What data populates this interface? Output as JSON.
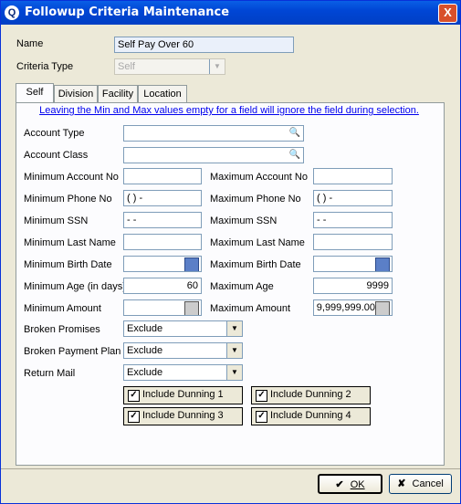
{
  "window": {
    "title": "Followup Criteria Maintenance",
    "close_glyph": "X",
    "icon": "search-app-icon"
  },
  "header": {
    "name_label": "Name",
    "name_value": "Self Pay Over 60",
    "criteria_type_label": "Criteria Type",
    "criteria_type_value": "Self"
  },
  "tabs": [
    {
      "label": "Self",
      "active": true
    },
    {
      "label": "Division",
      "active": false
    },
    {
      "label": "Facility",
      "active": false
    },
    {
      "label": "Location",
      "active": false
    }
  ],
  "notice": "Leaving the Min and Max values empty for a field will ignore the field during selection.",
  "fields": {
    "account_type": {
      "label": "Account Type",
      "value": ""
    },
    "account_class": {
      "label": "Account Class",
      "value": ""
    },
    "min_account_no": {
      "label": "Minimum Account No",
      "value": ""
    },
    "max_account_no": {
      "label": "Maximum Account No",
      "value": ""
    },
    "min_phone": {
      "label": "Minimum Phone No",
      "value": "(   )    -"
    },
    "max_phone": {
      "label": "Maximum Phone No",
      "value": "(   )    -"
    },
    "min_ssn": {
      "label": "Minimum SSN",
      "value": "  -   -"
    },
    "max_ssn": {
      "label": "Maximum SSN",
      "value": "  -   -"
    },
    "min_last_name": {
      "label": "Minimum Last Name",
      "value": ""
    },
    "max_last_name": {
      "label": "Maximum Last Name",
      "value": ""
    },
    "min_birth": {
      "label": "Minimum Birth Date",
      "value": ""
    },
    "max_birth": {
      "label": "Maximum Birth Date",
      "value": ""
    },
    "min_age": {
      "label": "Minimum Age (in days)",
      "value": "60"
    },
    "max_age": {
      "label": "Maximum Age",
      "value": "9999"
    },
    "min_amount": {
      "label": "Minimum Amount",
      "value": ""
    },
    "max_amount": {
      "label": "Maximum Amount",
      "value": "9,999,999.00"
    }
  },
  "dropdowns": {
    "broken_promises": {
      "label": "Broken Promises",
      "value": "Exclude"
    },
    "broken_payment_plan": {
      "label": "Broken Payment Plan",
      "value": "Exclude"
    },
    "return_mail": {
      "label": "Return Mail",
      "value": "Exclude"
    }
  },
  "checkboxes": [
    {
      "label": "Include Dunning 1",
      "checked": true
    },
    {
      "label": "Include Dunning 2",
      "checked": true
    },
    {
      "label": "Include Dunning 3",
      "checked": true
    },
    {
      "label": "Include Dunning 4",
      "checked": true
    }
  ],
  "check_glyph": "✓",
  "buttons": {
    "ok": "OK",
    "cancel": "Cancel",
    "ok_glyph": "✔",
    "cancel_glyph": "✘"
  },
  "colors": {
    "titlebar": "#0046d5",
    "link": "#0000ee",
    "dialog": "#ece9d8"
  }
}
